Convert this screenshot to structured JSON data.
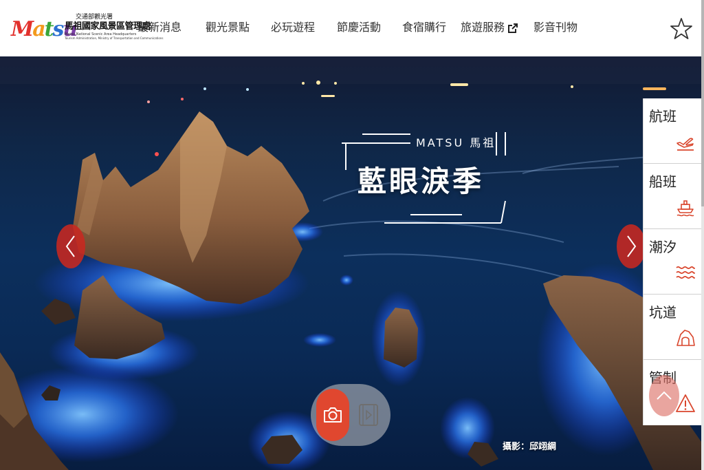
{
  "header": {
    "logo": {
      "mark_letters": [
        "M",
        "a",
        "t",
        "s",
        "u"
      ],
      "line1": "交通部觀光署",
      "line2": "馬祖國家風景區管理處",
      "line3": "Matsu National Scenic Area Headquarters",
      "line4": "Tourism Administration, Ministry of Transportation and Communications"
    },
    "nav": [
      {
        "label": "最新消息",
        "icon": null
      },
      {
        "label": "觀光景點",
        "icon": null
      },
      {
        "label": "必玩遊程",
        "icon": null
      },
      {
        "label": "節慶活動",
        "icon": null
      },
      {
        "label": "食宿購行",
        "icon": null
      },
      {
        "label": "旅遊服務",
        "icon": "external-link-icon"
      },
      {
        "label": "影音刊物",
        "icon": null
      }
    ],
    "favorite_icon": "star-outline-icon"
  },
  "hero": {
    "banner_subtitle": "MATSU 馬祖",
    "banner_title": "藍眼淚季",
    "photo_credit": "攝影：邱翊綱",
    "prev_icon": "chevron-left-icon",
    "next_icon": "chevron-right-icon",
    "media_toggle": {
      "photo_icon": "camera-icon",
      "video_icon": "film-play-icon",
      "active": "photo"
    }
  },
  "quick_panel": {
    "items": [
      {
        "label": "航班",
        "icon": "airplane-icon"
      },
      {
        "label": "船班",
        "icon": "ship-icon"
      },
      {
        "label": "潮汐",
        "icon": "waves-icon"
      },
      {
        "label": "坑道",
        "icon": "tunnel-icon"
      },
      {
        "label": "管制",
        "icon": "warning-icon"
      }
    ]
  },
  "back_to_top_icon": "chevron-up-icon",
  "colors": {
    "accent": "#d9452c",
    "nav_text": "#333333",
    "night_sea": "#0c2f5c",
    "blue_tear_glow": "#2f7dff"
  }
}
